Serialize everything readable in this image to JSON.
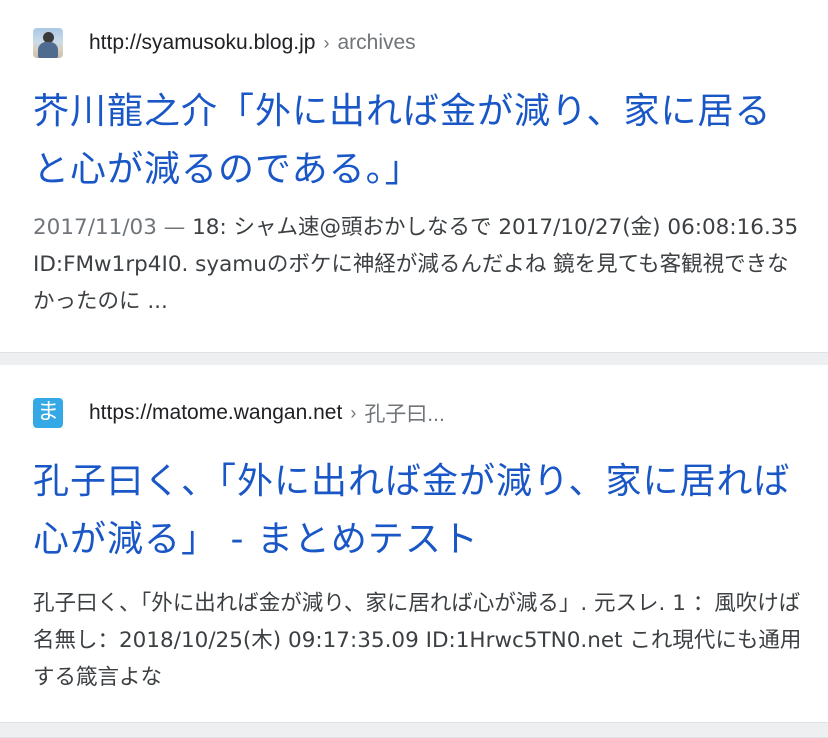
{
  "results": [
    {
      "favicon_icon": "person-photo-icon",
      "url": "http://syamusoku.blog.jp",
      "breadcrumb_separator": "›",
      "breadcrumb": "archives",
      "title": "芥川龍之介「外に出れば金が減り、家に居ると心が減るのである。」",
      "snippet_date": "2017/11/03 — ",
      "snippet_text": "18: シャム速@頭おかしなるで 2017/10/27(金) 06:08:16.35 ID:FMw1rp4I0. syamuのボケに神経が減るんだよね 鏡を見ても客観視できなかったのに ..."
    },
    {
      "favicon_icon": "ma-letter-icon",
      "favicon_text": "ま",
      "url": "https://matome.wangan.net",
      "breadcrumb_separator": "›",
      "breadcrumb": "孔子曰...",
      "title": "孔子曰く、「外に出れば金が減り、家に居れば心が減る」 - まとめテスト",
      "snippet_text": "孔子曰く、「外に出れば金が減り、家に居れば心が減る」. 元スレ. 1 ：風吹けば名無し：2018/10/25(木) 09:17:35.09 ID:1Hrwc5TN0.net これ現代にも通用する箴言よな"
    }
  ],
  "colors": {
    "title_link": "#1a57c6",
    "separator": "#eeeff1",
    "snippet_text": "#3c4043",
    "muted_text": "#70757a"
  }
}
